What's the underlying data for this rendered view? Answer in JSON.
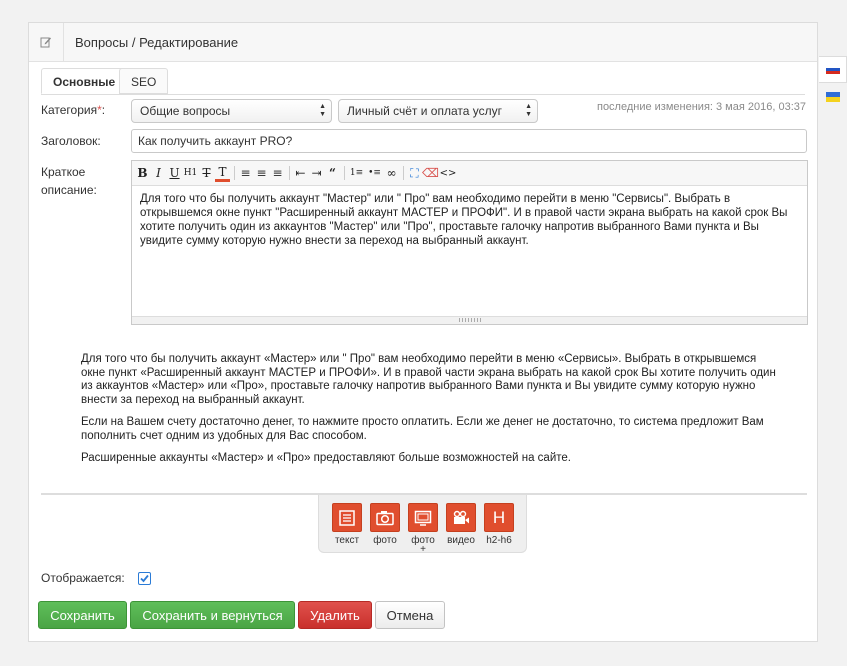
{
  "header": {
    "title": "Вопросы / Редактирование",
    "edit_icon": "edit-icon"
  },
  "languages": [
    {
      "name": "russian",
      "colors": [
        "#ffffff",
        "#2255c4",
        "#d52b1e"
      ]
    },
    {
      "name": "ukrainian",
      "colors": [
        "#2f6dd6",
        "#f4d21e"
      ]
    }
  ],
  "tabs": [
    {
      "label": "Основные",
      "active": true
    },
    {
      "label": "SEO",
      "active": false
    }
  ],
  "form": {
    "category_label": "Категория",
    "required_mark": "*",
    "category_colon": ":",
    "category_value": "Общие вопросы",
    "subcategory_value": "Личный счёт и оплата услуг",
    "last_change": "последние изменения: 3 мая 2016, 03:37",
    "title_label": "Заголовок:",
    "title_value": "Как получить аккаунт PRO?",
    "short_label_line1": "Краткое",
    "short_label_line2": "описание:",
    "short_text": "Для того что бы получить аккаунт \"Мастер\" или \" Про\" вам необходимо перейти в меню \"Сервисы\". Выбрать в открывшемся окне пункт \"Расширенный аккаунт МАСТЕР и ПРОФИ\". И в правой части экрана выбрать на какой срок Вы хотите получить один из аккаунтов \"Мастер\" или \"Про\", проставьте галочку напротив выбранного Вами пункта и Вы увидите сумму которую нужно внести за переход на выбранный аккаунт."
  },
  "editor_toolbar": [
    {
      "name": "bold",
      "glyph": "B"
    },
    {
      "name": "italic",
      "glyph": "I"
    },
    {
      "name": "underline",
      "glyph": "U"
    },
    {
      "name": "heading",
      "glyph": "H1"
    },
    {
      "name": "clear-format",
      "glyph": "T"
    },
    {
      "name": "text-color",
      "glyph": "T"
    },
    {
      "name": "align-left",
      "glyph": "≡"
    },
    {
      "name": "align-center",
      "glyph": "≡"
    },
    {
      "name": "align-right",
      "glyph": "≡"
    },
    {
      "name": "outdent",
      "glyph": "⇤"
    },
    {
      "name": "indent",
      "glyph": "⇥"
    },
    {
      "name": "blockquote",
      "glyph": "“"
    },
    {
      "name": "ordered-list",
      "glyph": "1≡"
    },
    {
      "name": "unordered-list",
      "glyph": "•≡"
    },
    {
      "name": "link",
      "glyph": "∞"
    },
    {
      "name": "fullscreen",
      "glyph": "⛶"
    },
    {
      "name": "eraser",
      "glyph": "⌫"
    },
    {
      "name": "source",
      "glyph": "<>"
    }
  ],
  "content": {
    "paragraphs": [
      "Для того что бы получить аккаунт «Мастер» или \" Про\" вам необходимо перейти в меню «Сервисы». Выбрать в открывшемся окне пункт «Расширенный аккаунт МАСТЕР и ПРОФИ». И в правой части экрана выбрать на какой срок Вы хотите получить один из аккаунтов «Мастер» или «Про», проставьте галочку напротив выбранного Вами пункта и Вы увидите сумму которую нужно внести за переход на выбранный аккаунт.",
      "Если на Вашем счету достаточно денег, то нажмите просто оплатить. Если же денег не достаточно, то система предложит Вам пополнить счет одним из удобных для Вас способом.",
      "Расширенные аккаунты «Мастер» и «Про» предоставляют больше возможностей на сайте."
    ]
  },
  "blocks": [
    {
      "label": "текст",
      "icon": "text-block-icon"
    },
    {
      "label": "фото",
      "icon": "camera-icon"
    },
    {
      "label": "фото",
      "label2": "+",
      "icon": "photo-gallery-icon"
    },
    {
      "label": "видео",
      "icon": "video-camera-icon"
    },
    {
      "label": "h2-h6",
      "glyph": "H",
      "icon": "heading-icon"
    }
  ],
  "visible": {
    "label": "Отображается:",
    "checked": true
  },
  "buttons": {
    "save": "Сохранить",
    "save_return": "Сохранить и вернуться",
    "delete": "Удалить",
    "cancel": "Отмена"
  },
  "colors": {
    "accent_red": "#e04e2e",
    "green": "#4aa545",
    "danger": "#c9302c",
    "check_blue": "#2b7bd6"
  }
}
